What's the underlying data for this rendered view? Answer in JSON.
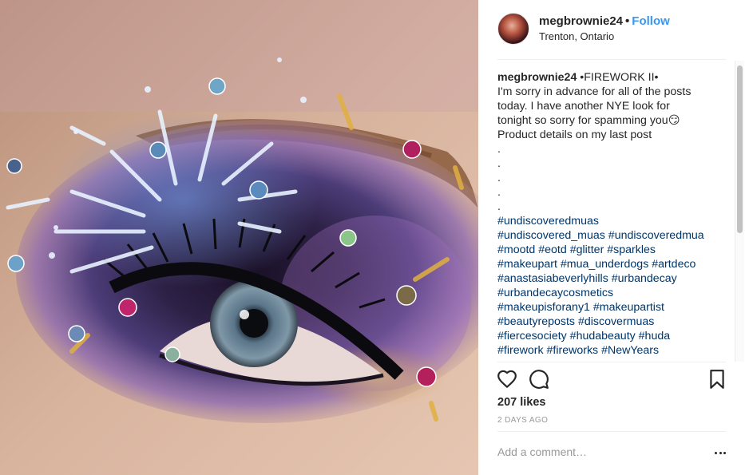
{
  "post": {
    "image_alt": "Close-up eye makeup with firework design, rhinestones and glitter",
    "author": {
      "username": "megbrownie24",
      "separator": "•",
      "follow_label": "Follow",
      "location": "Trenton, Ontario"
    },
    "caption": {
      "username": "megbrownie24",
      "title": " •FIREWORK II•",
      "lines": [
        "I'm sorry in advance for all of the posts",
        "today. I have another NYE look for",
        "tonight so sorry for spamming you😏",
        "Product details on my last post",
        ".",
        ".",
        ".",
        ".",
        "."
      ],
      "hashtag_lines": [
        "#undiscoveredmuas",
        "#undiscovered_muas #undiscoveredmua",
        "#mootd #eotd #glitter #sparkles",
        "#makeupart #mua_underdogs #artdeco",
        "#anastasiabeverlyhills #urbandecay",
        "#urbandecaycosmetics",
        "#makeupisforany1 #makeupartist",
        "#beautyreposts #discovermuas",
        "#fiercesociety #hudabeauty #huda",
        "#firework #fireworks #NewYears"
      ]
    },
    "likes": "207 likes",
    "timestamp": "2 DAYS AGO",
    "comment_placeholder": "Add a comment…",
    "icons": {
      "like": "heart-icon",
      "comment": "comment-bubble-icon",
      "save": "bookmark-icon",
      "more": "more-options-icon"
    },
    "colors": {
      "follow": "#3897f0",
      "hashtag": "#003569",
      "text": "#262626",
      "muted": "#999999"
    }
  }
}
